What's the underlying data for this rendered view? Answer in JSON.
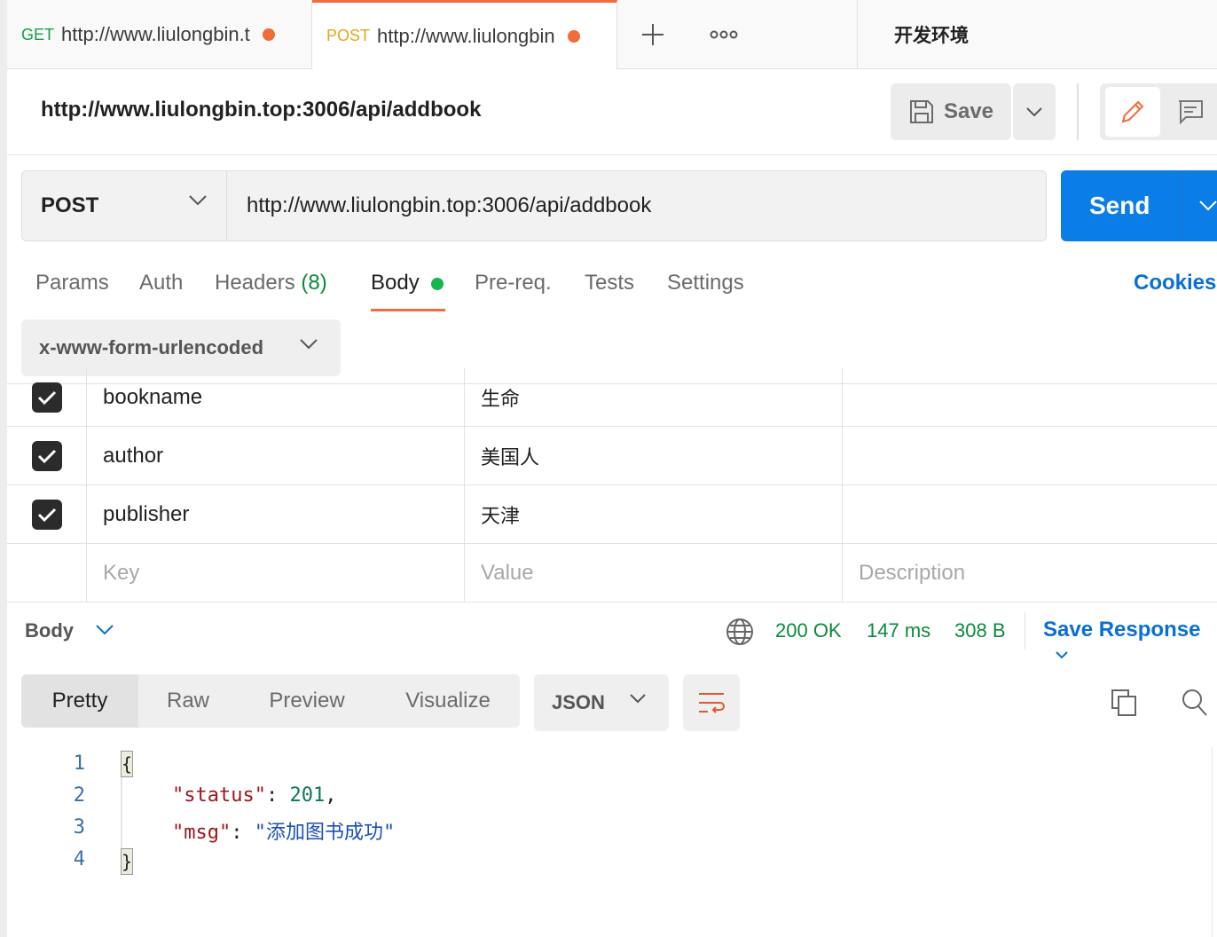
{
  "tabs": [
    {
      "method": "GET",
      "title": "http://www.liulongbin.t",
      "method_color": "#12a04a"
    },
    {
      "method": "POST",
      "title": "http://www.liulongbin",
      "method_color": "#e6a817"
    }
  ],
  "tab_actions": {
    "add_icon": "plus-icon",
    "more_icon": "more-horizontal-icon"
  },
  "environment": "开发环境",
  "request": {
    "title": "http://www.liulongbin.top:3006/api/addbook",
    "save_label": "Save",
    "method": "POST",
    "url": "http://www.liulongbin.top:3006/api/addbook",
    "send_label": "Send"
  },
  "subtabs": {
    "params": "Params",
    "auth": "Auth",
    "headers": "Headers",
    "headers_count": "(8)",
    "body": "Body",
    "prereq": "Pre-req.",
    "tests": "Tests",
    "settings": "Settings",
    "cookies": "Cookies"
  },
  "body_type": "x-www-form-urlencoded",
  "params_table": {
    "rows": [
      {
        "checked": true,
        "key": "bookname",
        "value": "生命",
        "description": ""
      },
      {
        "checked": true,
        "key": "author",
        "value": "美国人",
        "description": ""
      },
      {
        "checked": true,
        "key": "publisher",
        "value": "天津",
        "description": ""
      }
    ],
    "placeholder": {
      "key": "Key",
      "value": "Value",
      "description": "Description"
    }
  },
  "response": {
    "section_label": "Body",
    "status": "200 OK",
    "time": "147 ms",
    "size": "308 B",
    "save_response": "Save Response",
    "views": {
      "pretty": "Pretty",
      "raw": "Raw",
      "preview": "Preview",
      "visualize": "Visualize"
    },
    "format": "JSON",
    "lines": [
      "1",
      "2",
      "3",
      "4"
    ],
    "code": {
      "open": "{",
      "close": "}",
      "status_key": "\"status\"",
      "status_value": "201",
      "msg_key": "\"msg\"",
      "msg_value": "\"添加图书成功\""
    }
  },
  "colors": {
    "accent": "#f26b3a",
    "send": "#0a7de6",
    "success": "#0b8a3b",
    "link": "#0a6fd3"
  }
}
